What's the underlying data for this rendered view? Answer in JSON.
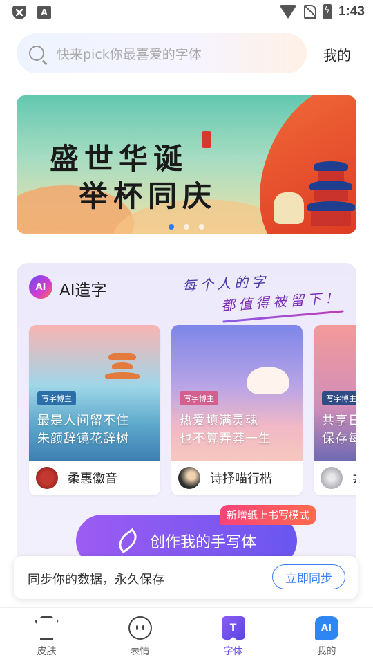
{
  "status_bar": {
    "time": "1:43",
    "a_icon_letter": "A"
  },
  "search": {
    "placeholder": "快来pick你最喜爱的字体"
  },
  "header": {
    "me_label": "我的"
  },
  "banner": {
    "line1": "盛世华诞",
    "line2": "举杯同庆",
    "active_slide": 1,
    "slide_count": 3
  },
  "ai_section": {
    "badge": "AI",
    "title": "AI造字",
    "slogan_line1": "每个人的字",
    "slogan_line2": "都值得被留下！",
    "cards": [
      {
        "tag": "写字博主",
        "text_line1": "最是人间留不住",
        "text_line2": "朱颜辞镜花辞树",
        "author": "柔惠徽音"
      },
      {
        "tag": "写字博主",
        "text_line1": "热爱填满灵魂",
        "text_line2": "也不算弄莽一生",
        "author": "诗抒喵行楷"
      },
      {
        "tag": "写字博主",
        "text_line1": "共享日",
        "text_line2": "保存每",
        "author": "井"
      }
    ],
    "create_button": "创作我的手写体",
    "new_tag": "新增纸上书写模式"
  },
  "sync": {
    "text": "同步你的数据，永久保存",
    "button": "立即同步"
  },
  "tabs": [
    {
      "label": "皮肤",
      "icon": "shirt-icon"
    },
    {
      "label": "表情",
      "icon": "face-icon"
    },
    {
      "label": "字体",
      "icon": "font-icon",
      "icon_glyph": "T"
    },
    {
      "label": "我的",
      "icon": "ai-icon",
      "icon_glyph": "AI"
    }
  ],
  "active_tab": "字体",
  "colors": {
    "accent": "#6a4cf5",
    "sync_blue": "#3b7cf2",
    "tag_red": "#f7437a"
  }
}
